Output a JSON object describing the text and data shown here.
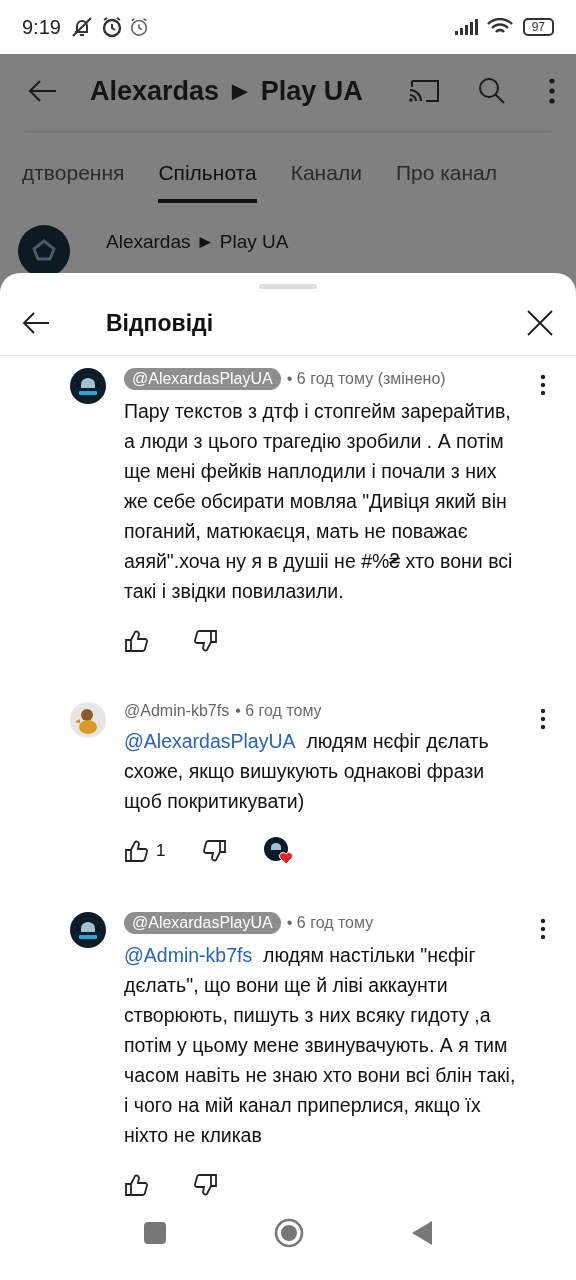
{
  "status_bar": {
    "time": "9:19",
    "battery": "97"
  },
  "channel_page": {
    "title": "Alexardas ► Play UA",
    "post_author": "Alexardas ► Play UA",
    "tabs": [
      {
        "label": "дтворення",
        "selected": false
      },
      {
        "label": "Спільнота",
        "selected": true
      },
      {
        "label": "Канали",
        "selected": false
      },
      {
        "label": "Про канал",
        "selected": false
      }
    ]
  },
  "sheet": {
    "title": "Відповіді"
  },
  "comments": [
    {
      "author": "@AlexardasPlayUA",
      "owner": true,
      "kind": "logo",
      "time": "• 6 год тому (змінено)",
      "text": "Пару текстов з дтф і стопгейм зарерайтив, а люди з цього трагедію зробили . А потім ще мені фейків наплодили і почали з них же себе обсирати мовляа \"Дивіця який він поганий, матюкаєця, мать не поважає аяяй\".хоча ну я в душіі не #%₴ хто вони всі такі і звідки повилазили.",
      "hearted": false
    },
    {
      "author": "@Admin-kb7fs",
      "owner": false,
      "kind": "duck",
      "time": "• 6 год тому",
      "mention": "@AlexardasPlayUA",
      "text": "людям нєфіг дєлать схоже, якщо вишукують однакові фрази щоб покритикувати)",
      "likes": "1",
      "hearted": true
    },
    {
      "author": "@AlexardasPlayUA",
      "owner": true,
      "kind": "logo",
      "time": "• 6 год тому",
      "mention": "@Admin-kb7fs",
      "text": "людям настільки \"нєфіг дєлать\",  що вони ще й ліві аккаунти створюють, пишуть з них всяку гидоту ,а потім у цьому мене звинувачують. А я тим часом навіть не знаю хто вони всі блін такі, і чого на мій канал приперлися, якщо їх ніхто не кликав",
      "hearted": false
    }
  ]
}
